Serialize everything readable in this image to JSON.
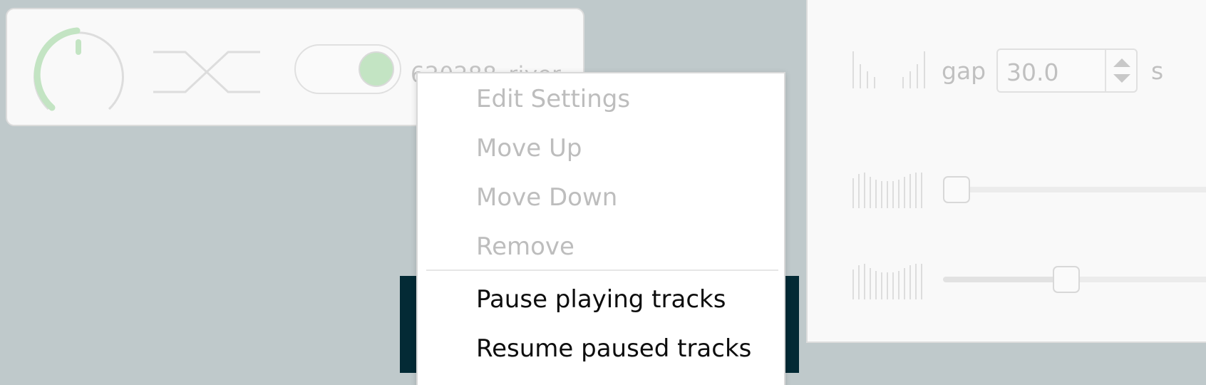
{
  "track": {
    "label": "620288_river",
    "volume_level": 0.42,
    "toggle_on": true
  },
  "right_panel": {
    "gap_label": "gap",
    "gap_value": "30.0",
    "gap_unit": "s",
    "slider1_level": 0.0,
    "slider2_level": 0.45
  },
  "context_menu": {
    "items": [
      {
        "label": "Edit Settings",
        "enabled": false
      },
      {
        "label": "Move Up",
        "enabled": false
      },
      {
        "label": "Move Down",
        "enabled": false
      },
      {
        "label": "Remove",
        "enabled": false
      },
      {
        "label": "Pause playing tracks",
        "enabled": true
      },
      {
        "label": "Resume paused tracks",
        "enabled": true
      }
    ]
  },
  "colors": {
    "background": "#bfc9cb",
    "accent_green": "#c3e4c3",
    "dark_block": "#032a35"
  }
}
